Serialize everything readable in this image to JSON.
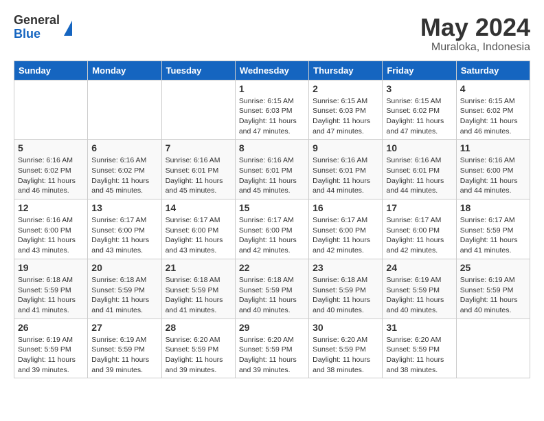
{
  "header": {
    "logo_general": "General",
    "logo_blue": "Blue",
    "month_title": "May 2024",
    "location": "Muraloka, Indonesia"
  },
  "days_of_week": [
    "Sunday",
    "Monday",
    "Tuesday",
    "Wednesday",
    "Thursday",
    "Friday",
    "Saturday"
  ],
  "weeks": [
    [
      {
        "day": "",
        "info": ""
      },
      {
        "day": "",
        "info": ""
      },
      {
        "day": "",
        "info": ""
      },
      {
        "day": "1",
        "sunrise": "6:15 AM",
        "sunset": "6:03 PM",
        "daylight": "11 hours and 47 minutes."
      },
      {
        "day": "2",
        "sunrise": "6:15 AM",
        "sunset": "6:03 PM",
        "daylight": "11 hours and 47 minutes."
      },
      {
        "day": "3",
        "sunrise": "6:15 AM",
        "sunset": "6:02 PM",
        "daylight": "11 hours and 47 minutes."
      },
      {
        "day": "4",
        "sunrise": "6:15 AM",
        "sunset": "6:02 PM",
        "daylight": "11 hours and 46 minutes."
      }
    ],
    [
      {
        "day": "5",
        "sunrise": "6:16 AM",
        "sunset": "6:02 PM",
        "daylight": "11 hours and 46 minutes."
      },
      {
        "day": "6",
        "sunrise": "6:16 AM",
        "sunset": "6:02 PM",
        "daylight": "11 hours and 45 minutes."
      },
      {
        "day": "7",
        "sunrise": "6:16 AM",
        "sunset": "6:01 PM",
        "daylight": "11 hours and 45 minutes."
      },
      {
        "day": "8",
        "sunrise": "6:16 AM",
        "sunset": "6:01 PM",
        "daylight": "11 hours and 45 minutes."
      },
      {
        "day": "9",
        "sunrise": "6:16 AM",
        "sunset": "6:01 PM",
        "daylight": "11 hours and 44 minutes."
      },
      {
        "day": "10",
        "sunrise": "6:16 AM",
        "sunset": "6:01 PM",
        "daylight": "11 hours and 44 minutes."
      },
      {
        "day": "11",
        "sunrise": "6:16 AM",
        "sunset": "6:00 PM",
        "daylight": "11 hours and 44 minutes."
      }
    ],
    [
      {
        "day": "12",
        "sunrise": "6:16 AM",
        "sunset": "6:00 PM",
        "daylight": "11 hours and 43 minutes."
      },
      {
        "day": "13",
        "sunrise": "6:17 AM",
        "sunset": "6:00 PM",
        "daylight": "11 hours and 43 minutes."
      },
      {
        "day": "14",
        "sunrise": "6:17 AM",
        "sunset": "6:00 PM",
        "daylight": "11 hours and 43 minutes."
      },
      {
        "day": "15",
        "sunrise": "6:17 AM",
        "sunset": "6:00 PM",
        "daylight": "11 hours and 42 minutes."
      },
      {
        "day": "16",
        "sunrise": "6:17 AM",
        "sunset": "6:00 PM",
        "daylight": "11 hours and 42 minutes."
      },
      {
        "day": "17",
        "sunrise": "6:17 AM",
        "sunset": "6:00 PM",
        "daylight": "11 hours and 42 minutes."
      },
      {
        "day": "18",
        "sunrise": "6:17 AM",
        "sunset": "5:59 PM",
        "daylight": "11 hours and 41 minutes."
      }
    ],
    [
      {
        "day": "19",
        "sunrise": "6:18 AM",
        "sunset": "5:59 PM",
        "daylight": "11 hours and 41 minutes."
      },
      {
        "day": "20",
        "sunrise": "6:18 AM",
        "sunset": "5:59 PM",
        "daylight": "11 hours and 41 minutes."
      },
      {
        "day": "21",
        "sunrise": "6:18 AM",
        "sunset": "5:59 PM",
        "daylight": "11 hours and 41 minutes."
      },
      {
        "day": "22",
        "sunrise": "6:18 AM",
        "sunset": "5:59 PM",
        "daylight": "11 hours and 40 minutes."
      },
      {
        "day": "23",
        "sunrise": "6:18 AM",
        "sunset": "5:59 PM",
        "daylight": "11 hours and 40 minutes."
      },
      {
        "day": "24",
        "sunrise": "6:19 AM",
        "sunset": "5:59 PM",
        "daylight": "11 hours and 40 minutes."
      },
      {
        "day": "25",
        "sunrise": "6:19 AM",
        "sunset": "5:59 PM",
        "daylight": "11 hours and 40 minutes."
      }
    ],
    [
      {
        "day": "26",
        "sunrise": "6:19 AM",
        "sunset": "5:59 PM",
        "daylight": "11 hours and 39 minutes."
      },
      {
        "day": "27",
        "sunrise": "6:19 AM",
        "sunset": "5:59 PM",
        "daylight": "11 hours and 39 minutes."
      },
      {
        "day": "28",
        "sunrise": "6:20 AM",
        "sunset": "5:59 PM",
        "daylight": "11 hours and 39 minutes."
      },
      {
        "day": "29",
        "sunrise": "6:20 AM",
        "sunset": "5:59 PM",
        "daylight": "11 hours and 39 minutes."
      },
      {
        "day": "30",
        "sunrise": "6:20 AM",
        "sunset": "5:59 PM",
        "daylight": "11 hours and 38 minutes."
      },
      {
        "day": "31",
        "sunrise": "6:20 AM",
        "sunset": "5:59 PM",
        "daylight": "11 hours and 38 minutes."
      },
      {
        "day": "",
        "info": ""
      }
    ]
  ]
}
